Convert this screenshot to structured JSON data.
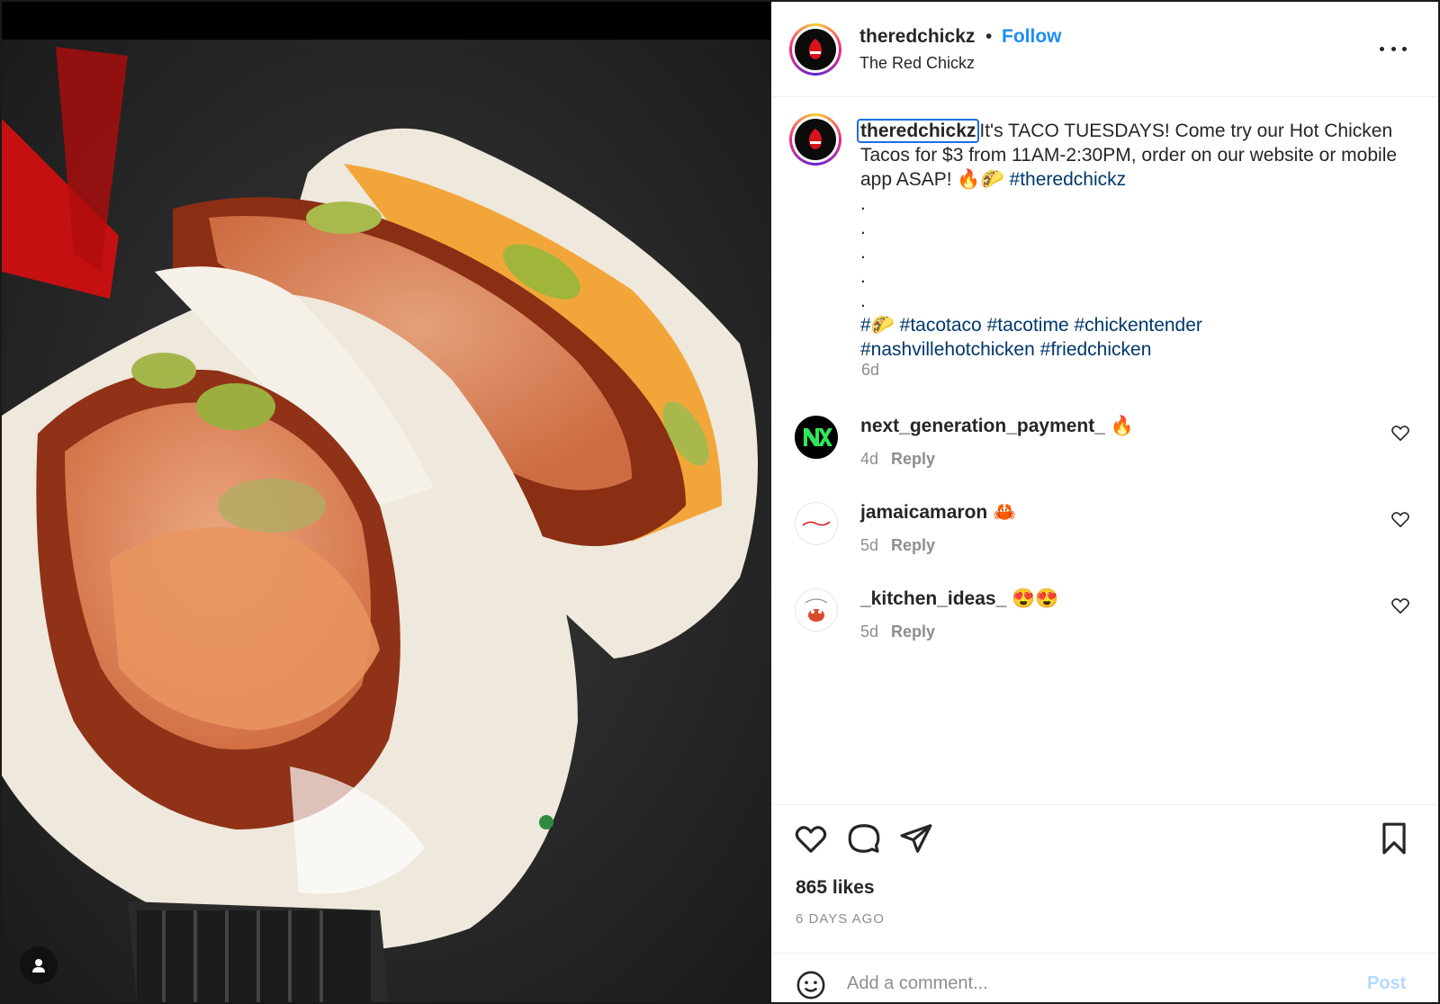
{
  "post": {
    "username": "theredchickz",
    "separator": "•",
    "follow_label": "Follow",
    "subtitle": "The Red Chickz",
    "more_icon": "more-horizontal-icon"
  },
  "caption": {
    "username": "theredchickz",
    "text": "It's TACO TUESDAYS! Come try our Hot Chicken Tacos for $3 from 11AM-2:30PM, order on our website or mobile app ASAP! 🔥🌮 ",
    "hashtag_inline": "#theredchickz",
    "dots": [
      ".",
      ".",
      ".",
      ".",
      "."
    ],
    "hashtags_line1": [
      "#🌮",
      "#tacotaco",
      "#tacotime",
      "#chickentender"
    ],
    "hashtags_line2": [
      "#nashvillehotchicken",
      "#friedchicken"
    ],
    "time": "6d"
  },
  "comments": [
    {
      "username": "next_generation_payment_",
      "emoji": "🔥",
      "time": "4d",
      "reply": "Reply"
    },
    {
      "username": "jamaicamaron",
      "emoji": "🦀",
      "time": "5d",
      "reply": "Reply"
    },
    {
      "username": "_kitchen_ideas_",
      "emoji": "😍😍",
      "time": "5d",
      "reply": "Reply"
    }
  ],
  "engagement": {
    "likes": "865 likes",
    "posted": "6 DAYS AGO"
  },
  "add_comment": {
    "placeholder": "Add a comment...",
    "post_label": "Post"
  },
  "colors": {
    "link_blue": "#1a8ef5",
    "hashtag": "#00376b",
    "muted": "#8e8e8e",
    "post_disabled": "#b3dbff"
  }
}
